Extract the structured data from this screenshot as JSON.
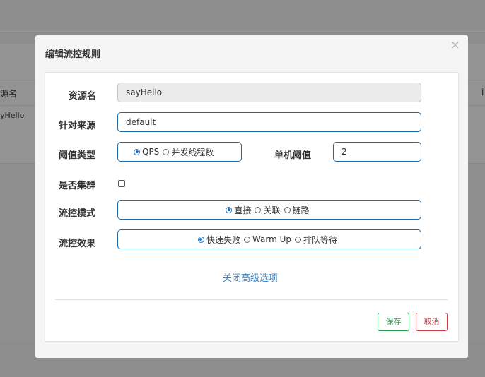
{
  "background": {
    "column_header_left": "源名",
    "column_header_right": "i",
    "cell_resource": "yHello"
  },
  "modal": {
    "title": "编辑流控规则",
    "close_symbol": "×",
    "fields": {
      "resource": {
        "label": "资源名",
        "value": "sayHello"
      },
      "source": {
        "label": "针对来源",
        "value": "default"
      },
      "threshold_type": {
        "label": "阈值类型",
        "options": [
          "QPS",
          "并发线程数"
        ],
        "selected": "QPS"
      },
      "single_threshold": {
        "label": "单机阈值",
        "value": "2"
      },
      "cluster": {
        "label": "是否集群",
        "checked": false
      },
      "flow_mode": {
        "label": "流控模式",
        "options": [
          "直接",
          "关联",
          "链路"
        ],
        "selected": "直接"
      },
      "flow_effect": {
        "label": "流控效果",
        "options": [
          "快速失败",
          "Warm Up",
          "排队等待"
        ],
        "selected": "快速失败"
      }
    },
    "advanced_link": "关闭高级选项",
    "buttons": {
      "save": "保存",
      "cancel": "取消"
    }
  }
}
